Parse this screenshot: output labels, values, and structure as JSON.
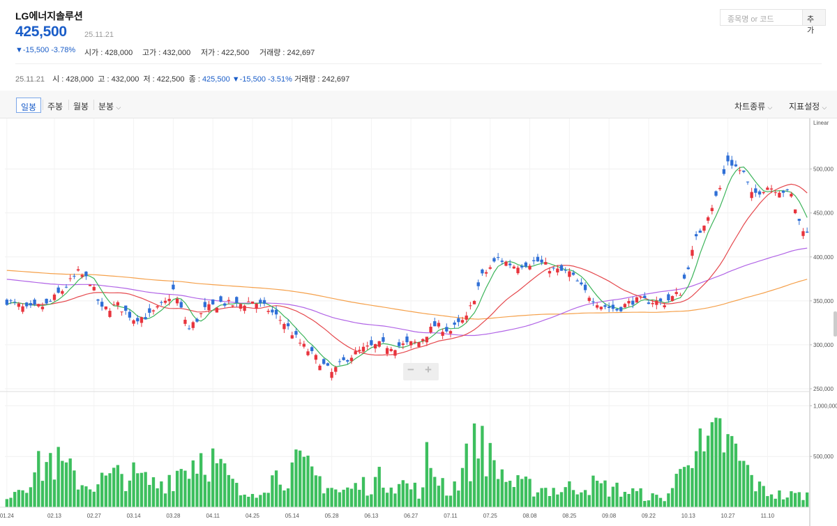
{
  "header": {
    "name": "LG에너지솔루션",
    "price": "425,500",
    "date": "25.11.21",
    "change": "▼-15,500 -3.78%",
    "open_label": "시가 : ",
    "open": "428,000",
    "high_label": "고가 : ",
    "high": "432,000",
    "low_label": "저가 : ",
    "low": "422,500",
    "volume_label": "거래량 : ",
    "volume": "242,697"
  },
  "search": {
    "placeholder": "종목명 or 코드",
    "add_label": "추가"
  },
  "ohlc_bar": {
    "date": "25.11.21",
    "open_label": "시 : ",
    "open": "428,000",
    "high_label": "고 : ",
    "high": "432,000",
    "low_label": "저 : ",
    "low": "422,500",
    "close_label": "종 : ",
    "close": "425,500",
    "change": "▼-15,500",
    "change_pct": "-3.51%",
    "volume_label": "거래량 : ",
    "volume": "242,697"
  },
  "toolbar": {
    "tabs": [
      "일봉",
      "주봉",
      "월봉",
      "분봉"
    ],
    "active_tab": "일봉",
    "chart_type_label": "차트종류",
    "indicator_label": "지표설정"
  },
  "zoom": {
    "minus": "−",
    "plus": "+"
  },
  "colors": {
    "up": "#e8343d",
    "down": "#2f6fd6",
    "ma5": "#3cb45a",
    "ma20": "#e5484d",
    "ma60": "#b164e6",
    "ma120": "#f5a04a",
    "volume": "#3dbf5e"
  },
  "chart_data": {
    "type": "candlestick",
    "scale_label": "Linear",
    "price_axis": {
      "ticks": [
        250000,
        300000,
        350000,
        400000,
        450000,
        500000
      ],
      "tick_labels": [
        "250,000",
        "300,000",
        "350,000",
        "400,000",
        "450,000",
        "500,000"
      ],
      "ylim": [
        250000,
        552000
      ]
    },
    "volume_axis": {
      "ticks": [
        500000,
        1000000
      ],
      "tick_labels": [
        "500,000",
        "1,000,000"
      ],
      "ylim": [
        0,
        1140000
      ]
    },
    "x_tick_labels": [
      {
        "i": 0,
        "label": "01.24"
      },
      {
        "i": 12,
        "label": "02.13"
      },
      {
        "i": 22,
        "label": "02.27"
      },
      {
        "i": 32,
        "label": "03.14"
      },
      {
        "i": 42,
        "label": "03.28"
      },
      {
        "i": 52,
        "label": "04.11"
      },
      {
        "i": 62,
        "label": "04.25"
      },
      {
        "i": 72,
        "label": "05.14"
      },
      {
        "i": 82,
        "label": "05.28"
      },
      {
        "i": 92,
        "label": "06.13"
      },
      {
        "i": 102,
        "label": "06.27"
      },
      {
        "i": 112,
        "label": "07.11"
      },
      {
        "i": 122,
        "label": "07.25"
      },
      {
        "i": 132,
        "label": "08.08"
      },
      {
        "i": 142,
        "label": "08.25"
      },
      {
        "i": 152,
        "label": "09.08"
      },
      {
        "i": 162,
        "label": "09.22"
      },
      {
        "i": 172,
        "label": "10.13"
      },
      {
        "i": 182,
        "label": "10.27"
      },
      {
        "i": 192,
        "label": "11.10"
      }
    ],
    "close_keyframes": [
      [
        0,
        350000
      ],
      [
        5,
        340000
      ],
      [
        10,
        345000
      ],
      [
        14,
        362000
      ],
      [
        18,
        382000
      ],
      [
        21,
        372000
      ],
      [
        24,
        340000
      ],
      [
        28,
        345000
      ],
      [
        32,
        330000
      ],
      [
        36,
        333000
      ],
      [
        40,
        348000
      ],
      [
        42,
        362000
      ],
      [
        46,
        318000
      ],
      [
        50,
        340000
      ],
      [
        54,
        348000
      ],
      [
        58,
        345000
      ],
      [
        62,
        350000
      ],
      [
        66,
        340000
      ],
      [
        70,
        325000
      ],
      [
        74,
        302000
      ],
      [
        78,
        285000
      ],
      [
        82,
        268000
      ],
      [
        86,
        285000
      ],
      [
        90,
        295000
      ],
      [
        94,
        300000
      ],
      [
        98,
        298000
      ],
      [
        104,
        303000
      ],
      [
        108,
        322000
      ],
      [
        112,
        316000
      ],
      [
        116,
        330000
      ],
      [
        120,
        378000
      ],
      [
        124,
        398000
      ],
      [
        128,
        390000
      ],
      [
        134,
        395000
      ],
      [
        138,
        385000
      ],
      [
        142,
        382000
      ],
      [
        146,
        360000
      ],
      [
        150,
        345000
      ],
      [
        154,
        340000
      ],
      [
        158,
        350000
      ],
      [
        162,
        350000
      ],
      [
        166,
        348000
      ],
      [
        170,
        360000
      ],
      [
        174,
        420000
      ],
      [
        178,
        458000
      ],
      [
        180,
        478000
      ],
      [
        182,
        510000
      ],
      [
        186,
        495000
      ],
      [
        188,
        470000
      ],
      [
        192,
        480000
      ],
      [
        196,
        475000
      ],
      [
        198,
        470000
      ],
      [
        200,
        440000
      ],
      [
        202,
        426000
      ]
    ],
    "volume_keyframes": [
      [
        0,
        150000
      ],
      [
        11,
        650000
      ],
      [
        20,
        300000
      ],
      [
        30,
        450000
      ],
      [
        38,
        300000
      ],
      [
        50,
        750000
      ],
      [
        60,
        120000
      ],
      [
        66,
        380000
      ],
      [
        74,
        550000
      ],
      [
        84,
        200000
      ],
      [
        96,
        400000
      ],
      [
        105,
        200000
      ],
      [
        106,
        640000
      ],
      [
        112,
        200000
      ],
      [
        120,
        1000000
      ],
      [
        122,
        620000
      ],
      [
        128,
        300000
      ],
      [
        140,
        230000
      ],
      [
        146,
        320000
      ],
      [
        158,
        200000
      ],
      [
        166,
        100000
      ],
      [
        170,
        450000
      ],
      [
        172,
        1000000
      ],
      [
        176,
        650000
      ],
      [
        180,
        970000
      ],
      [
        184,
        700000
      ],
      [
        190,
        250000
      ],
      [
        196,
        150000
      ],
      [
        202,
        170000
      ]
    ],
    "n_candles": 203,
    "moving_averages": [
      5,
      20,
      60,
      120
    ]
  }
}
